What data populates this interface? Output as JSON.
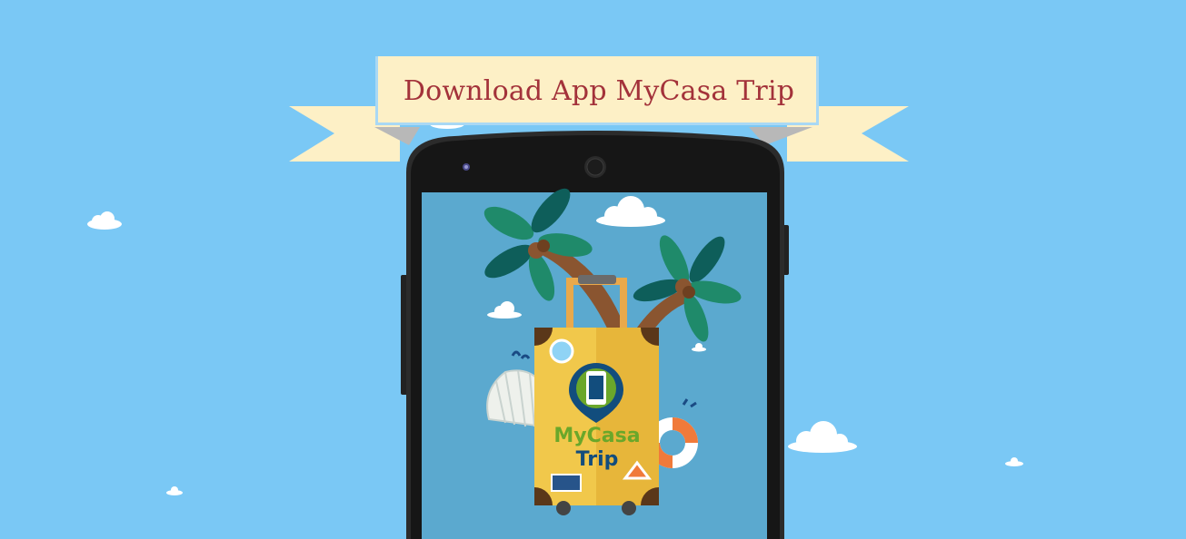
{
  "banner": {
    "title": "Download App MyCasa Trip"
  },
  "logo": {
    "line1": "MyCasa",
    "line2": "Trip"
  },
  "icons": [
    "cloud-icon",
    "palm-tree-icon",
    "suitcase-icon",
    "map-pin-icon",
    "seashell-icon",
    "life-ring-icon"
  ],
  "colors": {
    "sky": "#7ac8f5",
    "banner": "#fdf0c6",
    "banner_text": "#a3323a",
    "screen": "#5ba9cf",
    "suitcase": "#f1c84b",
    "logo_green": "#6aa72a",
    "logo_blue": "#124d7d"
  }
}
